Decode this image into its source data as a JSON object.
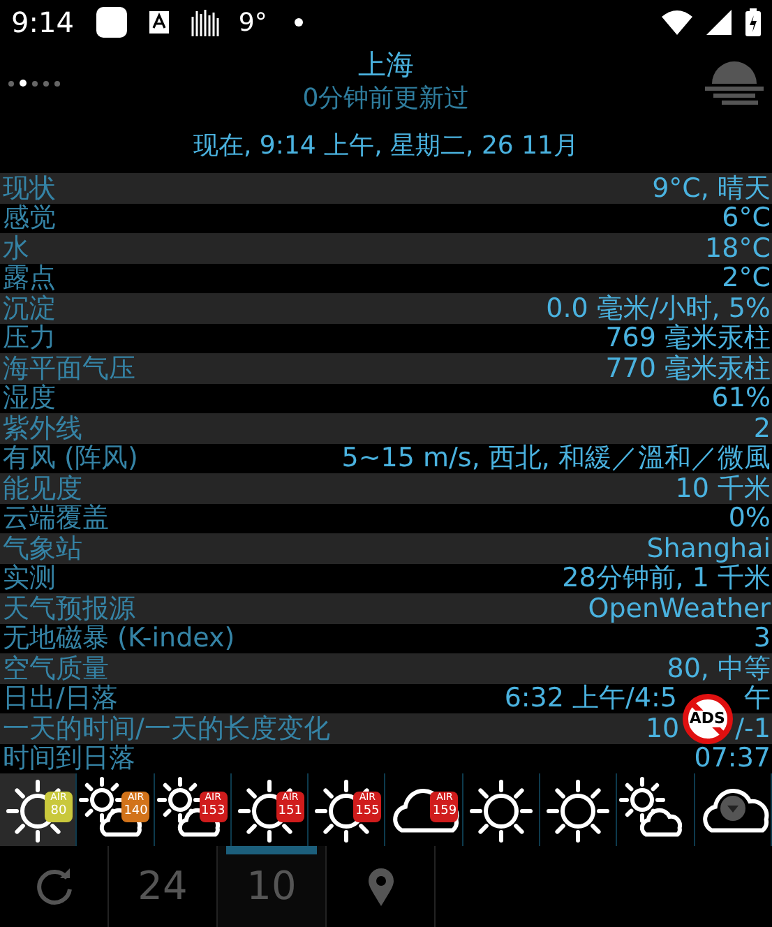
{
  "status_bar": {
    "time": "9:14",
    "temperature": "9°"
  },
  "header": {
    "city": "上海",
    "updated": "0分钟前更新过",
    "now": "现在, 9:14 上午, 星期二, 26 11月"
  },
  "page_dots": [
    {
      "selected": false
    },
    {
      "selected": true
    },
    {
      "selected": false
    },
    {
      "selected": false
    },
    {
      "selected": false
    }
  ],
  "rows": [
    {
      "label": "现状",
      "value": "9°C, 晴天"
    },
    {
      "label": "感觉",
      "value": "6°C"
    },
    {
      "label": "水",
      "value": "18°C"
    },
    {
      "label": "露点",
      "value": "2°C"
    },
    {
      "label": "沉淀",
      "value": "0.0 毫米/小时, 5%"
    },
    {
      "label": "压力",
      "value": "769 毫米汞柱"
    },
    {
      "label": "海平面气压",
      "value": "770 毫米汞柱"
    },
    {
      "label": "湿度",
      "value": "61%"
    },
    {
      "label": "紫外线",
      "value": "2"
    },
    {
      "label": "有风 (阵风)",
      "value": "5~15 m/s, 西北, 和緩／溫和／微風"
    },
    {
      "label": "能见度",
      "value": "10 千米"
    },
    {
      "label": "云端覆盖",
      "value": "0%"
    },
    {
      "label": "气象站",
      "value": "Shanghai"
    },
    {
      "label": "实测",
      "value": "28分钟前, 1 千米"
    },
    {
      "label": "天气预报源",
      "value": "OpenWeather"
    },
    {
      "label": "无地磁暴 (K-index)",
      "value": "3"
    },
    {
      "label": "空气质量",
      "value": "80, 中等"
    },
    {
      "label": "日出/日落",
      "value": "6:32 上午/4:5",
      "value_end": "午"
    },
    {
      "label": "一天的时间/一天的长度变化",
      "value": "10",
      "value_end": "/-1",
      "badge": "ADS"
    },
    {
      "label": "时间到日落",
      "value": "07:37"
    }
  ],
  "forecast": [
    {
      "kind": "sun",
      "selected": true,
      "air_label": "AIR",
      "air": "80",
      "color": "#c9c83c"
    },
    {
      "kind": "sun-cloud",
      "selected": false,
      "air_label": "AIR",
      "air": "140",
      "color": "#d2731a"
    },
    {
      "kind": "sun-cloud",
      "selected": false,
      "air_label": "AIR",
      "air": "153",
      "color": "#d01c1c"
    },
    {
      "kind": "sun",
      "selected": false,
      "air_label": "AIR",
      "air": "151",
      "color": "#d01c1c"
    },
    {
      "kind": "sun",
      "selected": false,
      "air_label": "AIR",
      "air": "155",
      "color": "#d01c1c"
    },
    {
      "kind": "cloud",
      "selected": false,
      "air_label": "AIR",
      "air": "159",
      "color": "#d01c1c"
    },
    {
      "kind": "sun",
      "selected": false
    },
    {
      "kind": "sun",
      "selected": false
    },
    {
      "kind": "sun-cloud",
      "selected": false
    },
    {
      "kind": "dark-cloud",
      "selected": false
    }
  ],
  "bottom_bar": [
    {
      "kind": "refresh"
    },
    {
      "kind": "text",
      "text": "24",
      "selected": false
    },
    {
      "kind": "text",
      "text": "10",
      "selected": true
    },
    {
      "kind": "pin"
    }
  ]
}
